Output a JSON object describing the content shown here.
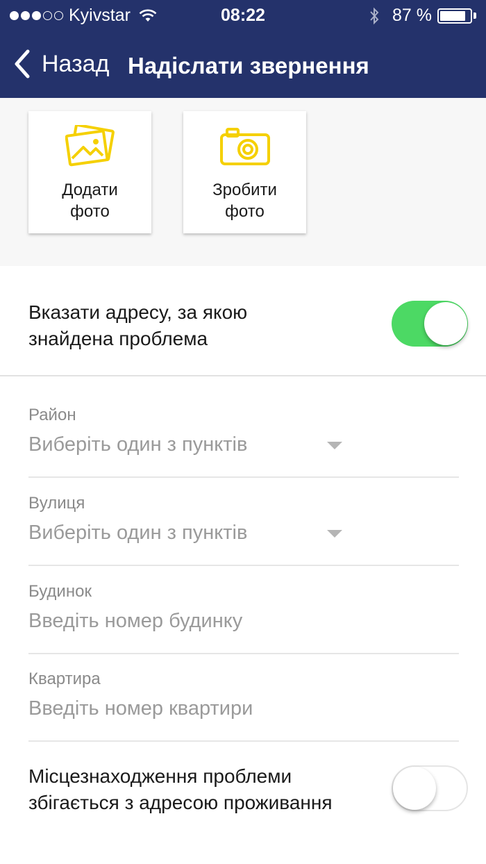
{
  "status_bar": {
    "carrier": "Kyivstar",
    "signal_bars_filled": 3,
    "signal_bars_total": 5,
    "time": "08:22",
    "battery_percent_text": "87 %",
    "battery_level": 0.87,
    "icons": [
      "wifi-icon",
      "bluetooth-icon",
      "battery-icon"
    ]
  },
  "nav": {
    "back_label": "Назад",
    "title": "Надіслати звернення",
    "back_icon": "chevron-left-icon"
  },
  "photos": {
    "add_photo_label": "Додати\nфото",
    "add_photo_icon": "photo-gallery-icon",
    "take_photo_label": "Зробити\nфото",
    "take_photo_icon": "camera-icon"
  },
  "address_toggle": {
    "label": "Вказати адресу, за якою\nзнайдена проблема",
    "enabled": true
  },
  "form": {
    "district": {
      "label": "Район",
      "placeholder": "Виберіть один з пунктів"
    },
    "street": {
      "label": "Вулиця",
      "placeholder": "Виберіть один з пунктів"
    },
    "house": {
      "label": "Будинок",
      "placeholder": "Введіть номер будинку"
    },
    "apartment": {
      "label": "Квартира",
      "placeholder": "Введіть номер квартири"
    }
  },
  "match_toggle": {
    "label": "Місцезнаходження проблеми\nзбігається з адресою проживання",
    "enabled": false
  },
  "colors": {
    "header_bg": "#24326b",
    "accent_yellow": "#f5d000",
    "toggle_on": "#4cd964"
  }
}
